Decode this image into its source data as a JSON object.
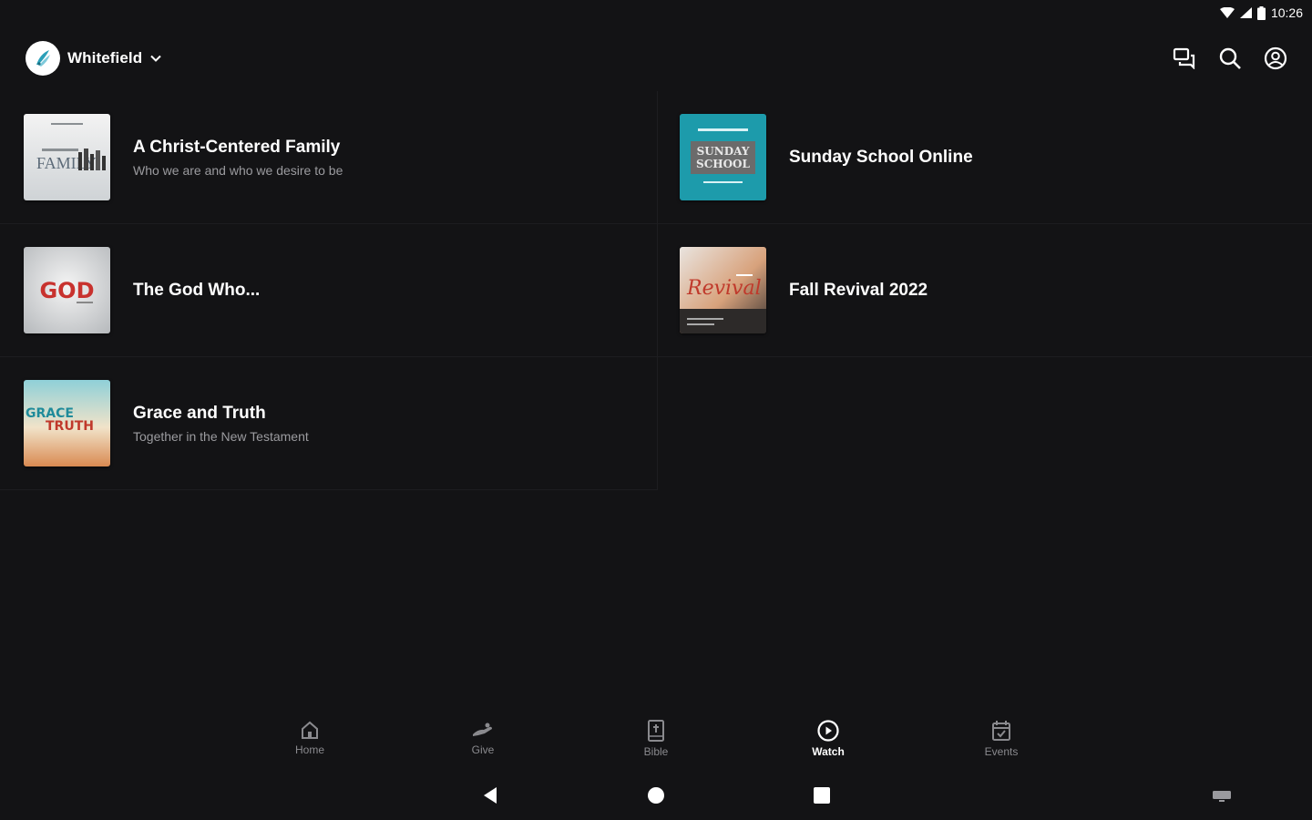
{
  "status_bar": {
    "time": "10:26"
  },
  "header": {
    "church_name": "Whitefield"
  },
  "series": [
    {
      "title": "A Christ-Centered Family",
      "subtitle": "Who we are and who we desire to be",
      "thumb_text": "FAMILY"
    },
    {
      "title": "Sunday School Online",
      "subtitle": "",
      "thumb_text": "SUNDAY SCHOOL"
    },
    {
      "title": "The God Who...",
      "subtitle": "",
      "thumb_text": "GOD"
    },
    {
      "title": "Fall Revival 2022",
      "subtitle": "",
      "thumb_text": "Revival"
    },
    {
      "title": "Grace and Truth",
      "subtitle": "Together in the New Testament",
      "thumb_text": "GRACE TRUTH"
    }
  ],
  "nav": {
    "home": "Home",
    "give": "Give",
    "bible": "Bible",
    "watch": "Watch",
    "events": "Events",
    "active": "watch"
  },
  "icons": {
    "chat": "chat-icon",
    "search": "search-icon",
    "account": "account-icon"
  },
  "colors": {
    "background": "#131315",
    "text_primary": "#ffffff",
    "text_secondary": "#9b9b9f",
    "nav_inactive": "#8a8a8e"
  }
}
